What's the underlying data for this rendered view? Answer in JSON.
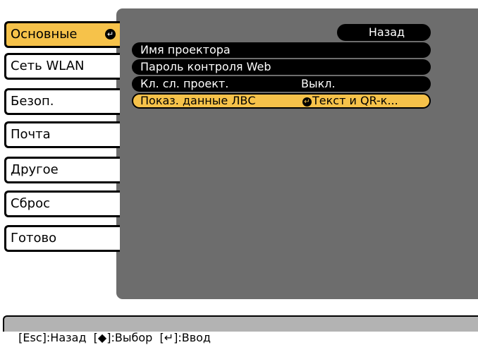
{
  "sidebar": {
    "items": [
      {
        "label": "Основные",
        "active": true
      },
      {
        "label": "Сеть WLAN"
      },
      {
        "label": "Безоп."
      },
      {
        "label": "Почта"
      },
      {
        "label": "Другое"
      },
      {
        "label": "Сброс"
      },
      {
        "label": "Готово"
      }
    ],
    "enter_glyph": "↵"
  },
  "main": {
    "back_label": "Назад",
    "rows": [
      {
        "label": "Имя проектора",
        "value": ""
      },
      {
        "label": "Пароль контроля Web",
        "value": ""
      },
      {
        "label": "Кл. сл. проект.",
        "value": "Выкл."
      },
      {
        "label": "Показ. данные ЛВС",
        "value": "Текст и QR-к...",
        "selected": true
      }
    ]
  },
  "footer": {
    "text": "[Esc]:Назад  [◆]:Выбор  [↵]:Ввод"
  },
  "colors": {
    "accent": "#f6c24a",
    "panel": "#6d6d6d",
    "footer": "#b3b3b3"
  }
}
